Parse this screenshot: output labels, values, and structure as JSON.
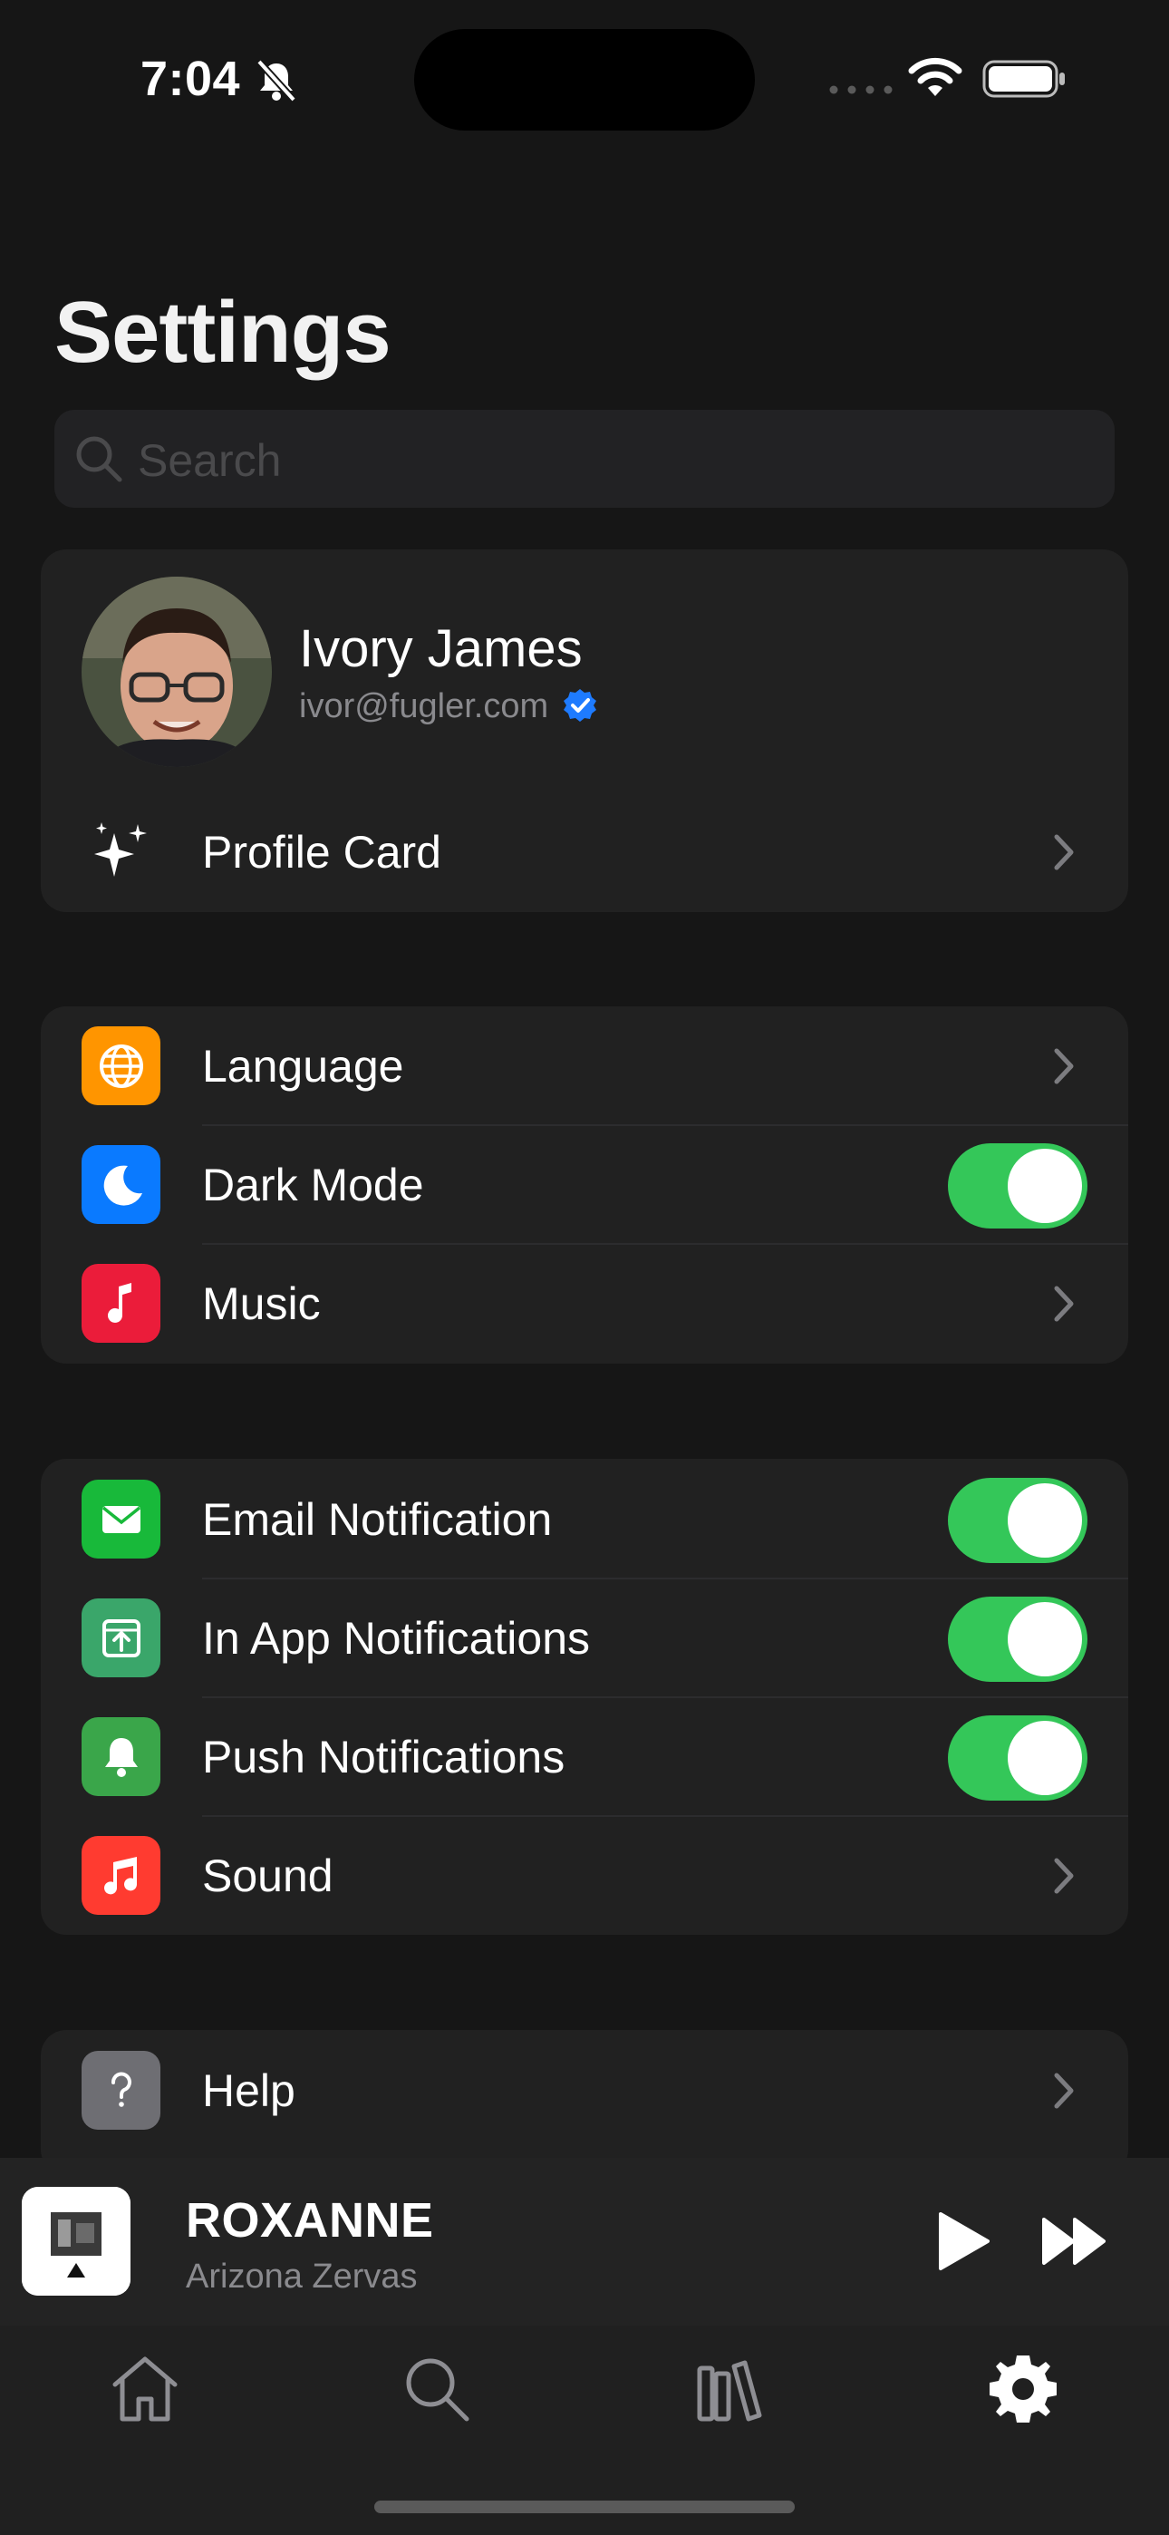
{
  "status_bar": {
    "time": "7:04"
  },
  "page_title": "Settings",
  "search": {
    "placeholder": "Search"
  },
  "profile": {
    "name": "Ivory James",
    "email": "ivor@fugler.com",
    "card_label": "Profile Card"
  },
  "general": {
    "items": [
      {
        "label": "Language",
        "icon": "globe-icon",
        "color": "#ff9500",
        "control": "chevron"
      },
      {
        "label": "Dark Mode",
        "icon": "moon-icon",
        "color": "#0a7aff",
        "control": "toggle",
        "on": true
      },
      {
        "label": "Music",
        "icon": "music-note-icon",
        "color": "#eb1c3a",
        "control": "chevron"
      }
    ]
  },
  "notifications": {
    "items": [
      {
        "label": "Email Notification",
        "icon": "envelope-icon",
        "color": "#18b93a",
        "control": "toggle",
        "on": true
      },
      {
        "label": "In App Notifications",
        "icon": "app-badge-icon",
        "color": "#3aa66a",
        "control": "toggle",
        "on": true
      },
      {
        "label": "Push Notifications",
        "icon": "bell-icon",
        "color": "#3aa64a",
        "control": "toggle",
        "on": true
      },
      {
        "label": "Sound",
        "icon": "music-notes-icon",
        "color": "#ff3b30",
        "control": "chevron"
      }
    ]
  },
  "support": {
    "items": [
      {
        "label": "Help",
        "icon": "question-mark-icon",
        "color": "#6e6e73",
        "control": "chevron"
      }
    ]
  },
  "now_playing": {
    "title": "ROXANNE",
    "artist": "Arizona Zervas"
  },
  "tab_bar": {
    "tabs": [
      {
        "icon": "home-icon",
        "active": false
      },
      {
        "icon": "search-icon",
        "active": false
      },
      {
        "icon": "library-icon",
        "active": false
      },
      {
        "icon": "gear-icon",
        "active": true
      }
    ]
  },
  "colors": {
    "accent_green": "#34c759",
    "background": "#161616",
    "card": "#212121"
  }
}
